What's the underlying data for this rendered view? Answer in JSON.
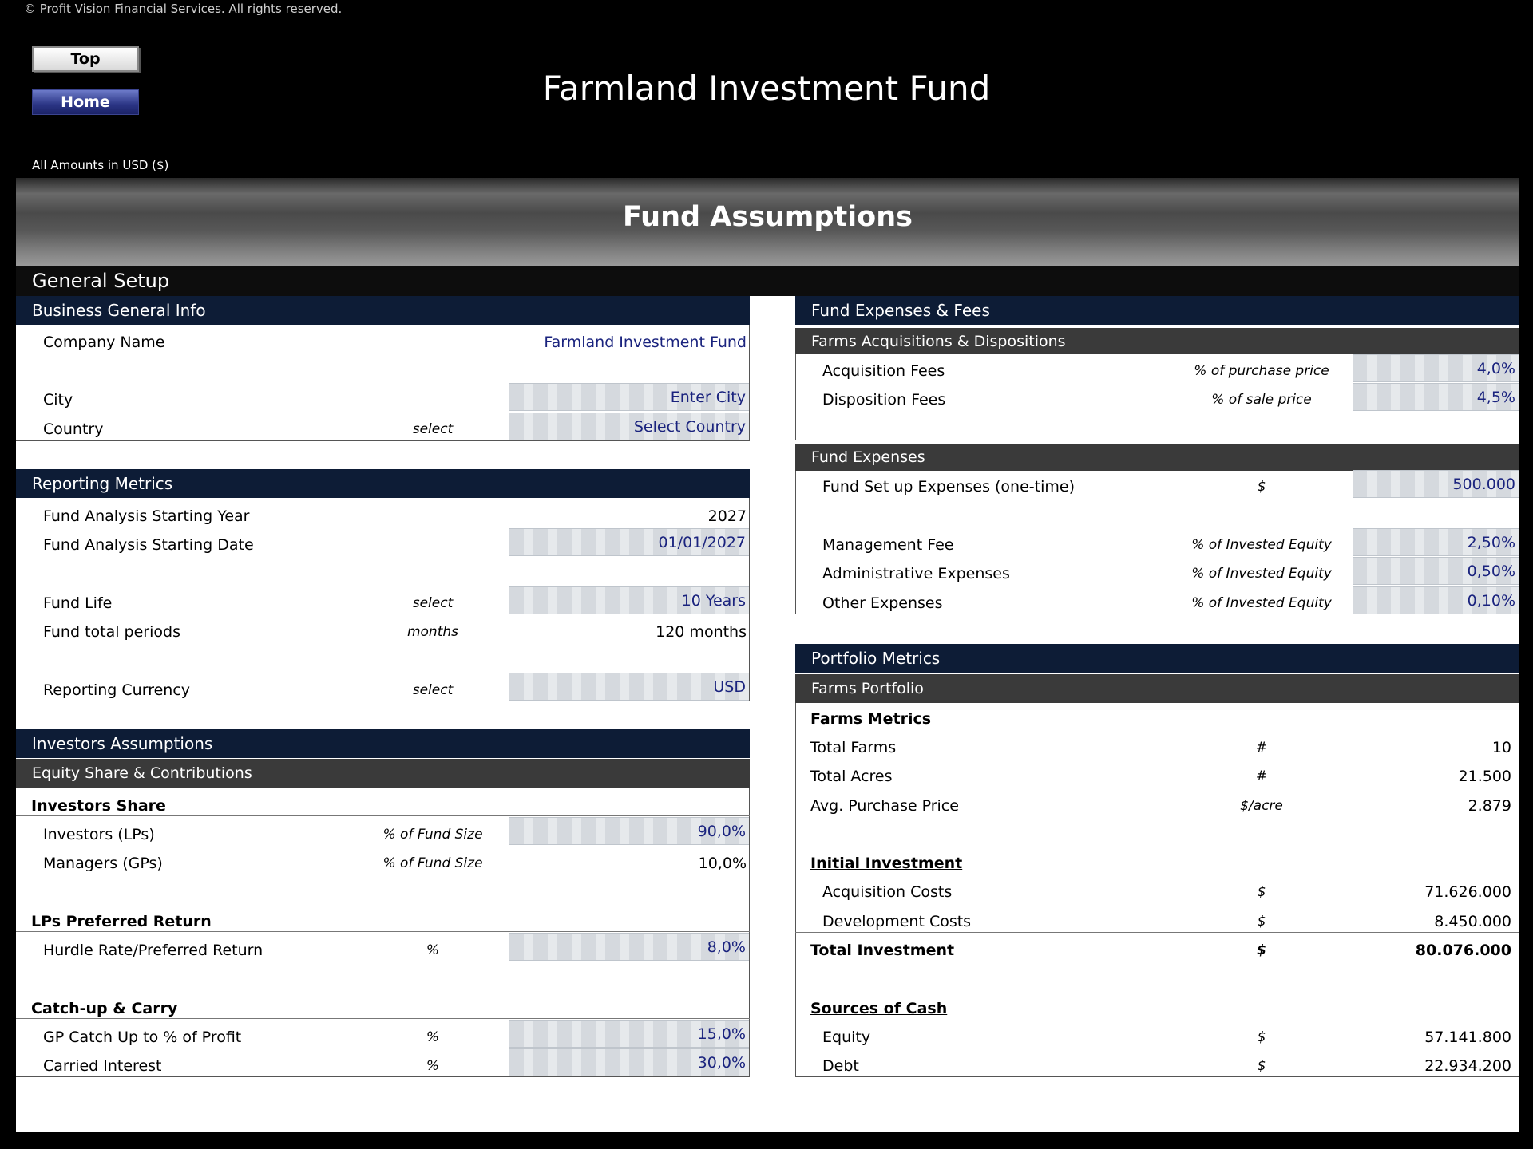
{
  "copyright": "© Profit Vision Financial Services. All rights reserved.",
  "nav": {
    "top_label": "Top",
    "home_label": "Home"
  },
  "header": {
    "title": "Farmland Investment Fund",
    "currency_note": "All Amounts in  USD ($)"
  },
  "banner": {
    "title": "Fund Assumptions"
  },
  "general_setup": {
    "title": "General Setup"
  },
  "business": {
    "title": "Business General Info",
    "company_label": "Company Name",
    "company_value": "Farmland Investment Fund",
    "city_label": "City",
    "city_value": "Enter City",
    "country_label": "Country",
    "country_unit": "select",
    "country_value": "Select Country"
  },
  "reporting": {
    "title": "Reporting Metrics",
    "start_year_label": "Fund Analysis Starting Year",
    "start_year_value": "2027",
    "start_date_label": "Fund Analysis Starting Date",
    "start_date_value": "01/01/2027",
    "fund_life_label": "Fund Life",
    "fund_life_unit": "select",
    "fund_life_value": "10 Years",
    "periods_label": "Fund total periods",
    "periods_unit": "months",
    "periods_value": "120 months",
    "currency_label": "Reporting Currency",
    "currency_unit": "select",
    "currency_value": "USD"
  },
  "investors": {
    "title": "Investors Assumptions",
    "subtitle": "Equity Share & Contributions",
    "share_heading": "Investors Share",
    "lps_label": "Investors (LPs)",
    "lps_unit": "% of Fund Size",
    "lps_value": "90,0%",
    "gps_label": "Managers (GPs)",
    "gps_unit": "% of Fund Size",
    "gps_value": "10,0%",
    "pref_heading": "LPs Preferred Return",
    "hurdle_label": "Hurdle Rate/Preferred Return",
    "hurdle_unit": "%",
    "hurdle_value": "8,0%",
    "carry_heading": "Catch-up & Carry",
    "catchup_label": "GP Catch Up to % of Profit",
    "catchup_unit": "%",
    "catchup_value": "15,0%",
    "carried_label": "Carried Interest",
    "carried_unit": "%",
    "carried_value": "30,0%"
  },
  "expenses": {
    "title": "Fund Expenses & Fees",
    "acq_title": "Farms Acquisitions & Dispositions",
    "acq_fee_label": "Acquisition Fees",
    "acq_fee_unit": "% of purchase price",
    "acq_fee_value": "4,0%",
    "disp_fee_label": "Disposition Fees",
    "disp_fee_unit": "% of sale price",
    "disp_fee_value": "4,5%",
    "fund_exp_title": "Fund Expenses",
    "setup_label": "Fund Set up Expenses (one-time)",
    "setup_unit": "$",
    "setup_value": "500.000",
    "mgmt_label": "Management Fee",
    "mgmt_unit": "% of Invested Equity",
    "mgmt_value": "2,50%",
    "admin_label": "Administrative Expenses",
    "admin_unit": "% of Invested Equity",
    "admin_value": "0,50%",
    "other_label": "Other Expenses",
    "other_unit": "% of Invested Equity",
    "other_value": "0,10%"
  },
  "portfolio": {
    "title": "Portfolio Metrics",
    "subtitle": "Farms Portfolio",
    "metrics_heading": "Farms Metrics",
    "farms_label": "Total Farms",
    "farms_unit": "#",
    "farms_value": "10",
    "acres_label": "Total Acres",
    "acres_unit": "#",
    "acres_value": "21.500",
    "price_label": "Avg. Purchase Price",
    "price_unit": "$/acre",
    "price_value": "2.879",
    "invest_heading": "Initial Investment",
    "acqcost_label": "Acquisition Costs",
    "acqcost_unit": "$",
    "acqcost_value": "71.626.000",
    "devcost_label": "Development Costs",
    "devcost_unit": "$",
    "devcost_value": "8.450.000",
    "total_label": "Total Investment",
    "total_unit": "$",
    "total_value": "80.076.000",
    "sources_heading": "Sources of Cash",
    "equity_label": "Equity",
    "equity_unit": "$",
    "equity_value": "57.141.800",
    "debt_label": "Debt",
    "debt_unit": "$",
    "debt_value": "22.934.200"
  }
}
